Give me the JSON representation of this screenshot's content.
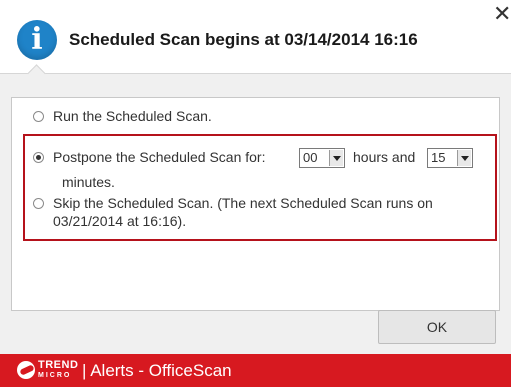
{
  "window": {
    "title": "Scheduled Scan begins at 03/14/2014 16:16",
    "close_glyph": "✕"
  },
  "icons": {
    "info": "info-icon",
    "info_glyph": "i"
  },
  "options": {
    "run": {
      "label": "Run the Scheduled Scan.",
      "checked": false
    },
    "postpone": {
      "label_before": "Postpone the Scheduled Scan for:",
      "hours_value": "00",
      "hours_label": "hours and",
      "minutes_value": "15",
      "minutes_label": "minutes.",
      "checked": true
    },
    "skip": {
      "label_line1": "Skip the Scheduled Scan. (The next Scheduled Scan runs on",
      "label_line2": "03/21/2014 at 16:16).",
      "checked": false
    }
  },
  "buttons": {
    "ok_label": "OK"
  },
  "footer": {
    "brand_top": "TREND",
    "brand_bottom": "MICRO",
    "text": "| Alerts - OfficeScan"
  },
  "colors": {
    "accent_red": "#d71920",
    "highlight_border": "#b5121b",
    "info_blue": "#1f83c8"
  }
}
